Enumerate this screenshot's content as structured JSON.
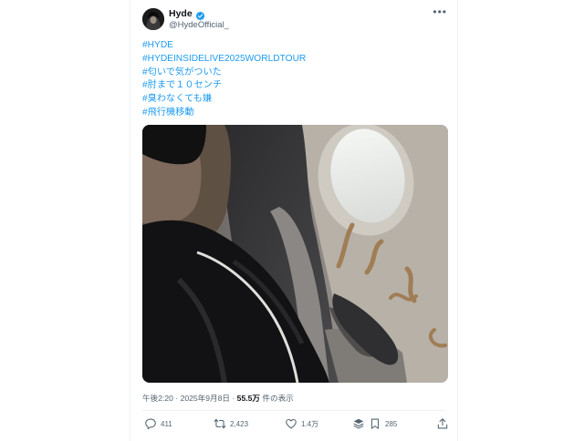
{
  "author": {
    "name": "Hyde",
    "handle": "@HydeOfficial_"
  },
  "tweet": {
    "lines": [
      "#HYDE",
      "#HYDEINSIDELIVE2025WORLDTOUR",
      "#匂いで気がついた",
      "#肘まで１０センチ",
      "#臭わなくても嫌",
      "#飛行機移動"
    ]
  },
  "meta": {
    "time": "午後2:20",
    "separator1": " · ",
    "date": "2025年9月8日",
    "separator2": " · ",
    "views": "55.5万",
    "views_suffix": " 件の表示"
  },
  "actions": {
    "replies": "411",
    "retweets": "2,423",
    "likes": "1.4万",
    "bookmarks": "285"
  },
  "colors": {
    "accent": "#1d9bf0",
    "muted": "#536471",
    "text": "#0f1419"
  }
}
